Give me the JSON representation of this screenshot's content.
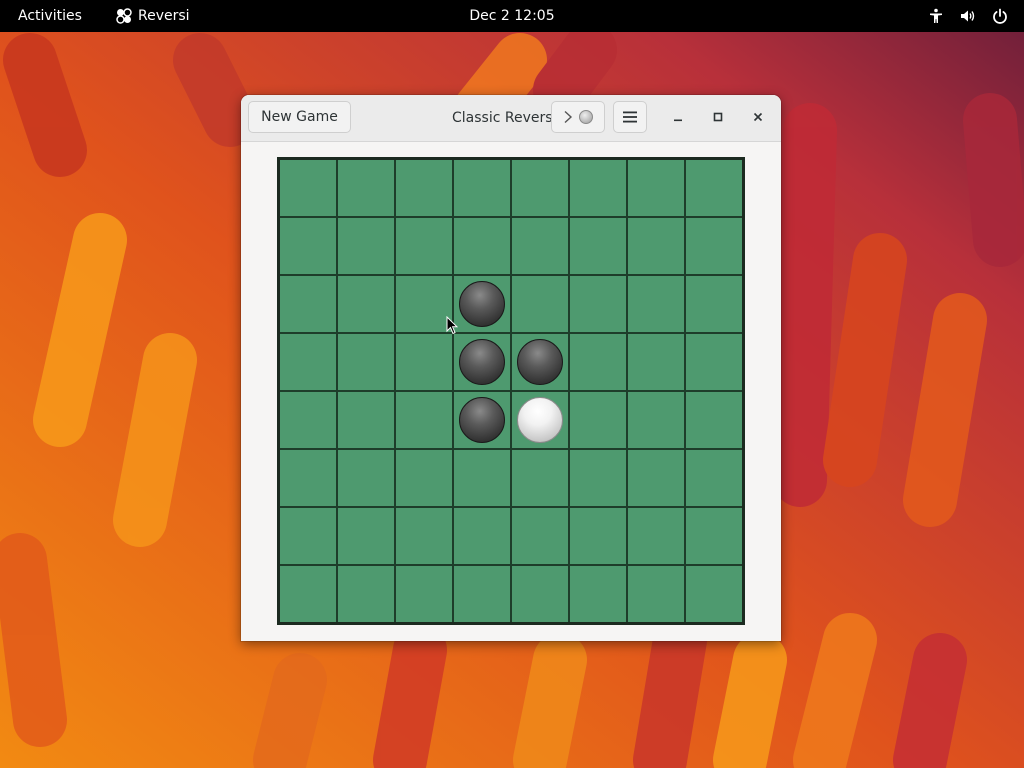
{
  "topbar": {
    "activities": "Activities",
    "app_name": "Reversi",
    "app_icon": "reversi-app-icon",
    "clock": "Dec 2  12:05",
    "tray_icons": [
      "accessibility-icon",
      "volume-icon",
      "power-icon"
    ]
  },
  "window": {
    "title": "Classic Reversi",
    "new_game_label": "New Game",
    "turn_indicator": {
      "arrow": ">",
      "current_player": "light"
    },
    "menu_icon": "hamburger-menu-icon",
    "controls": [
      "minimize-icon",
      "maximize-icon",
      "close-icon"
    ]
  },
  "board": {
    "size": 8,
    "colors": {
      "cell": "#4e9a6f",
      "grid": "#1e3d2a",
      "border": "#1c2a20",
      "dark_disc": "#333333",
      "light_disc": "#f2f2f2"
    },
    "rows": [
      "........",
      "........",
      "...D....",
      "...DD...",
      "...DL...",
      "........",
      "........",
      "........"
    ]
  }
}
